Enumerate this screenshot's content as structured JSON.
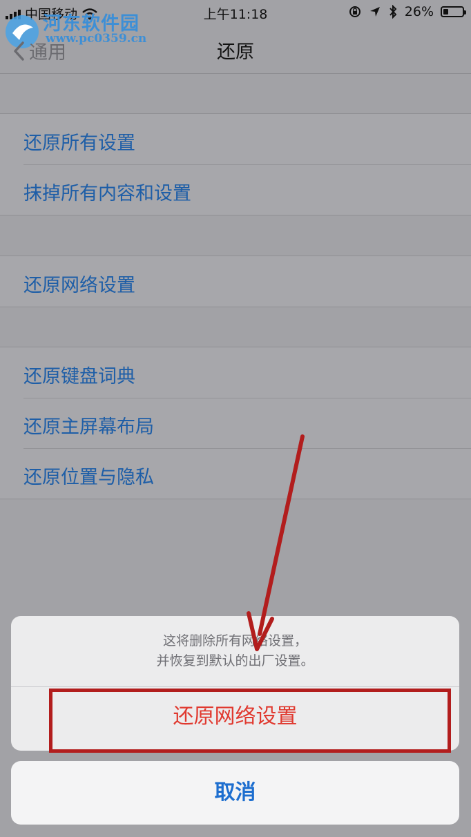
{
  "status_bar": {
    "carrier": "中国移动",
    "time": "上午11:18",
    "battery": "26%",
    "battery_level": 0.26
  },
  "watermark": {
    "name": "河东软件园",
    "url": "www.pc0359.cn"
  },
  "nav": {
    "back_label": "通用",
    "title": "还原"
  },
  "groups": [
    {
      "items": [
        {
          "label": "还原所有设置"
        },
        {
          "label": "抹掉所有内容和设置"
        }
      ]
    },
    {
      "items": [
        {
          "label": "还原网络设置"
        }
      ]
    },
    {
      "items": [
        {
          "label": "还原键盘词典"
        },
        {
          "label": "还原主屏幕布局"
        },
        {
          "label": "还原位置与隐私"
        }
      ]
    }
  ],
  "action_sheet": {
    "message_line1": "这将删除所有网络设置，",
    "message_line2": "并恢复到默认的出厂设置。",
    "confirm_label": "还原网络设置",
    "cancel_label": "取消"
  },
  "colors": {
    "accent_blue": "#1d6ecf",
    "destructive_red": "#e0392f",
    "annotation_red": "#b21d1d"
  }
}
